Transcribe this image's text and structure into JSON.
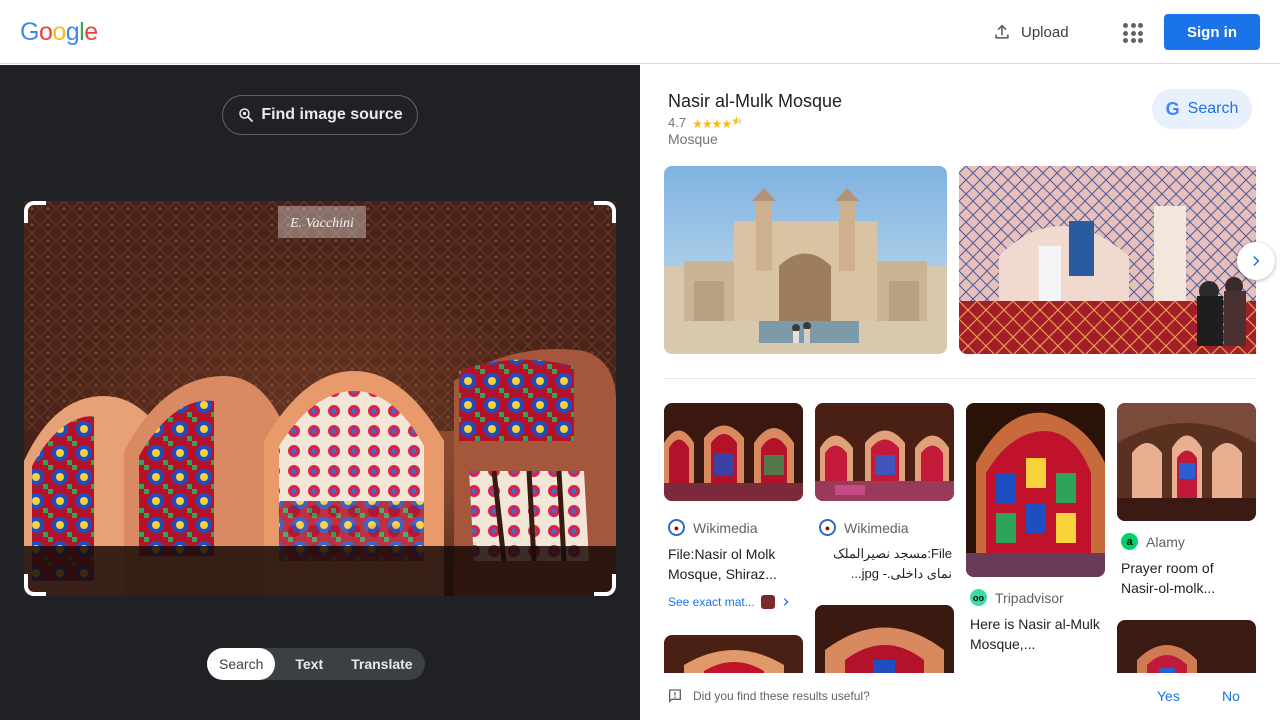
{
  "header": {
    "logo_letters": [
      "G",
      "o",
      "o",
      "g",
      "l",
      "e"
    ],
    "logo_colors": [
      "#4285f4",
      "#ea4335",
      "#fbbc05",
      "#4285f4",
      "#34a853",
      "#ea4335"
    ],
    "upload_label": "Upload",
    "apps_icon": "apps-grid-icon",
    "signin_label": "Sign in"
  },
  "left": {
    "find_source_label": "Find image source",
    "watermark_text": "E. Vacchini",
    "tabs": [
      "Search",
      "Text",
      "Translate"
    ],
    "active_tab": "Search"
  },
  "place": {
    "title": "Nasir al-Mulk Mosque",
    "rating": "4.7",
    "stars": 4.7,
    "category": "Mosque",
    "search_label": "Search"
  },
  "results": [
    {
      "source": "Wikimedia",
      "title": "File:Nasir ol Molk Mosque, Shiraz...",
      "see_exact": "See exact mat...",
      "rtl": false
    },
    {
      "source": "Wikimedia",
      "title": "File:مسجد نصیرالملک نمای داخلی.- jpg...",
      "rtl": true
    },
    {
      "source": "Tripadvisor",
      "title": "Here is Nasir al-Mulk Mosque,..."
    },
    {
      "source": "Alamy",
      "title": "Prayer room of Nasir-ol-molk..."
    }
  ],
  "feedback": {
    "question": "Did you find these results useful?",
    "yes_label": "Yes",
    "no_label": "No"
  },
  "colors": {
    "accent": "#1a73e8",
    "dark_panel": "#202124",
    "star": "#fbbc04"
  }
}
